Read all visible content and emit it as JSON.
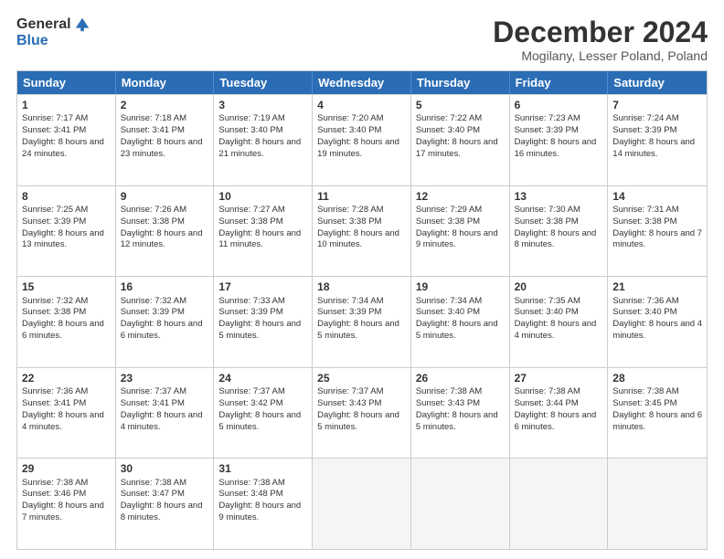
{
  "header": {
    "logo_general": "General",
    "logo_blue": "Blue",
    "month_title": "December 2024",
    "location": "Mogilany, Lesser Poland, Poland"
  },
  "days_of_week": [
    "Sunday",
    "Monday",
    "Tuesday",
    "Wednesday",
    "Thursday",
    "Friday",
    "Saturday"
  ],
  "weeks": [
    [
      {
        "day": "1",
        "sunrise": "Sunrise: 7:17 AM",
        "sunset": "Sunset: 3:41 PM",
        "daylight": "Daylight: 8 hours and 24 minutes."
      },
      {
        "day": "2",
        "sunrise": "Sunrise: 7:18 AM",
        "sunset": "Sunset: 3:41 PM",
        "daylight": "Daylight: 8 hours and 23 minutes."
      },
      {
        "day": "3",
        "sunrise": "Sunrise: 7:19 AM",
        "sunset": "Sunset: 3:40 PM",
        "daylight": "Daylight: 8 hours and 21 minutes."
      },
      {
        "day": "4",
        "sunrise": "Sunrise: 7:20 AM",
        "sunset": "Sunset: 3:40 PM",
        "daylight": "Daylight: 8 hours and 19 minutes."
      },
      {
        "day": "5",
        "sunrise": "Sunrise: 7:22 AM",
        "sunset": "Sunset: 3:40 PM",
        "daylight": "Daylight: 8 hours and 17 minutes."
      },
      {
        "day": "6",
        "sunrise": "Sunrise: 7:23 AM",
        "sunset": "Sunset: 3:39 PM",
        "daylight": "Daylight: 8 hours and 16 minutes."
      },
      {
        "day": "7",
        "sunrise": "Sunrise: 7:24 AM",
        "sunset": "Sunset: 3:39 PM",
        "daylight": "Daylight: 8 hours and 14 minutes."
      }
    ],
    [
      {
        "day": "8",
        "sunrise": "Sunrise: 7:25 AM",
        "sunset": "Sunset: 3:39 PM",
        "daylight": "Daylight: 8 hours and 13 minutes."
      },
      {
        "day": "9",
        "sunrise": "Sunrise: 7:26 AM",
        "sunset": "Sunset: 3:38 PM",
        "daylight": "Daylight: 8 hours and 12 minutes."
      },
      {
        "day": "10",
        "sunrise": "Sunrise: 7:27 AM",
        "sunset": "Sunset: 3:38 PM",
        "daylight": "Daylight: 8 hours and 11 minutes."
      },
      {
        "day": "11",
        "sunrise": "Sunrise: 7:28 AM",
        "sunset": "Sunset: 3:38 PM",
        "daylight": "Daylight: 8 hours and 10 minutes."
      },
      {
        "day": "12",
        "sunrise": "Sunrise: 7:29 AM",
        "sunset": "Sunset: 3:38 PM",
        "daylight": "Daylight: 8 hours and 9 minutes."
      },
      {
        "day": "13",
        "sunrise": "Sunrise: 7:30 AM",
        "sunset": "Sunset: 3:38 PM",
        "daylight": "Daylight: 8 hours and 8 minutes."
      },
      {
        "day": "14",
        "sunrise": "Sunrise: 7:31 AM",
        "sunset": "Sunset: 3:38 PM",
        "daylight": "Daylight: 8 hours and 7 minutes."
      }
    ],
    [
      {
        "day": "15",
        "sunrise": "Sunrise: 7:32 AM",
        "sunset": "Sunset: 3:38 PM",
        "daylight": "Daylight: 8 hours and 6 minutes."
      },
      {
        "day": "16",
        "sunrise": "Sunrise: 7:32 AM",
        "sunset": "Sunset: 3:39 PM",
        "daylight": "Daylight: 8 hours and 6 minutes."
      },
      {
        "day": "17",
        "sunrise": "Sunrise: 7:33 AM",
        "sunset": "Sunset: 3:39 PM",
        "daylight": "Daylight: 8 hours and 5 minutes."
      },
      {
        "day": "18",
        "sunrise": "Sunrise: 7:34 AM",
        "sunset": "Sunset: 3:39 PM",
        "daylight": "Daylight: 8 hours and 5 minutes."
      },
      {
        "day": "19",
        "sunrise": "Sunrise: 7:34 AM",
        "sunset": "Sunset: 3:40 PM",
        "daylight": "Daylight: 8 hours and 5 minutes."
      },
      {
        "day": "20",
        "sunrise": "Sunrise: 7:35 AM",
        "sunset": "Sunset: 3:40 PM",
        "daylight": "Daylight: 8 hours and 4 minutes."
      },
      {
        "day": "21",
        "sunrise": "Sunrise: 7:36 AM",
        "sunset": "Sunset: 3:40 PM",
        "daylight": "Daylight: 8 hours and 4 minutes."
      }
    ],
    [
      {
        "day": "22",
        "sunrise": "Sunrise: 7:36 AM",
        "sunset": "Sunset: 3:41 PM",
        "daylight": "Daylight: 8 hours and 4 minutes."
      },
      {
        "day": "23",
        "sunrise": "Sunrise: 7:37 AM",
        "sunset": "Sunset: 3:41 PM",
        "daylight": "Daylight: 8 hours and 4 minutes."
      },
      {
        "day": "24",
        "sunrise": "Sunrise: 7:37 AM",
        "sunset": "Sunset: 3:42 PM",
        "daylight": "Daylight: 8 hours and 5 minutes."
      },
      {
        "day": "25",
        "sunrise": "Sunrise: 7:37 AM",
        "sunset": "Sunset: 3:43 PM",
        "daylight": "Daylight: 8 hours and 5 minutes."
      },
      {
        "day": "26",
        "sunrise": "Sunrise: 7:38 AM",
        "sunset": "Sunset: 3:43 PM",
        "daylight": "Daylight: 8 hours and 5 minutes."
      },
      {
        "day": "27",
        "sunrise": "Sunrise: 7:38 AM",
        "sunset": "Sunset: 3:44 PM",
        "daylight": "Daylight: 8 hours and 6 minutes."
      },
      {
        "day": "28",
        "sunrise": "Sunrise: 7:38 AM",
        "sunset": "Sunset: 3:45 PM",
        "daylight": "Daylight: 8 hours and 6 minutes."
      }
    ],
    [
      {
        "day": "29",
        "sunrise": "Sunrise: 7:38 AM",
        "sunset": "Sunset: 3:46 PM",
        "daylight": "Daylight: 8 hours and 7 minutes."
      },
      {
        "day": "30",
        "sunrise": "Sunrise: 7:38 AM",
        "sunset": "Sunset: 3:47 PM",
        "daylight": "Daylight: 8 hours and 8 minutes."
      },
      {
        "day": "31",
        "sunrise": "Sunrise: 7:38 AM",
        "sunset": "Sunset: 3:48 PM",
        "daylight": "Daylight: 8 hours and 9 minutes."
      },
      null,
      null,
      null,
      null
    ]
  ]
}
